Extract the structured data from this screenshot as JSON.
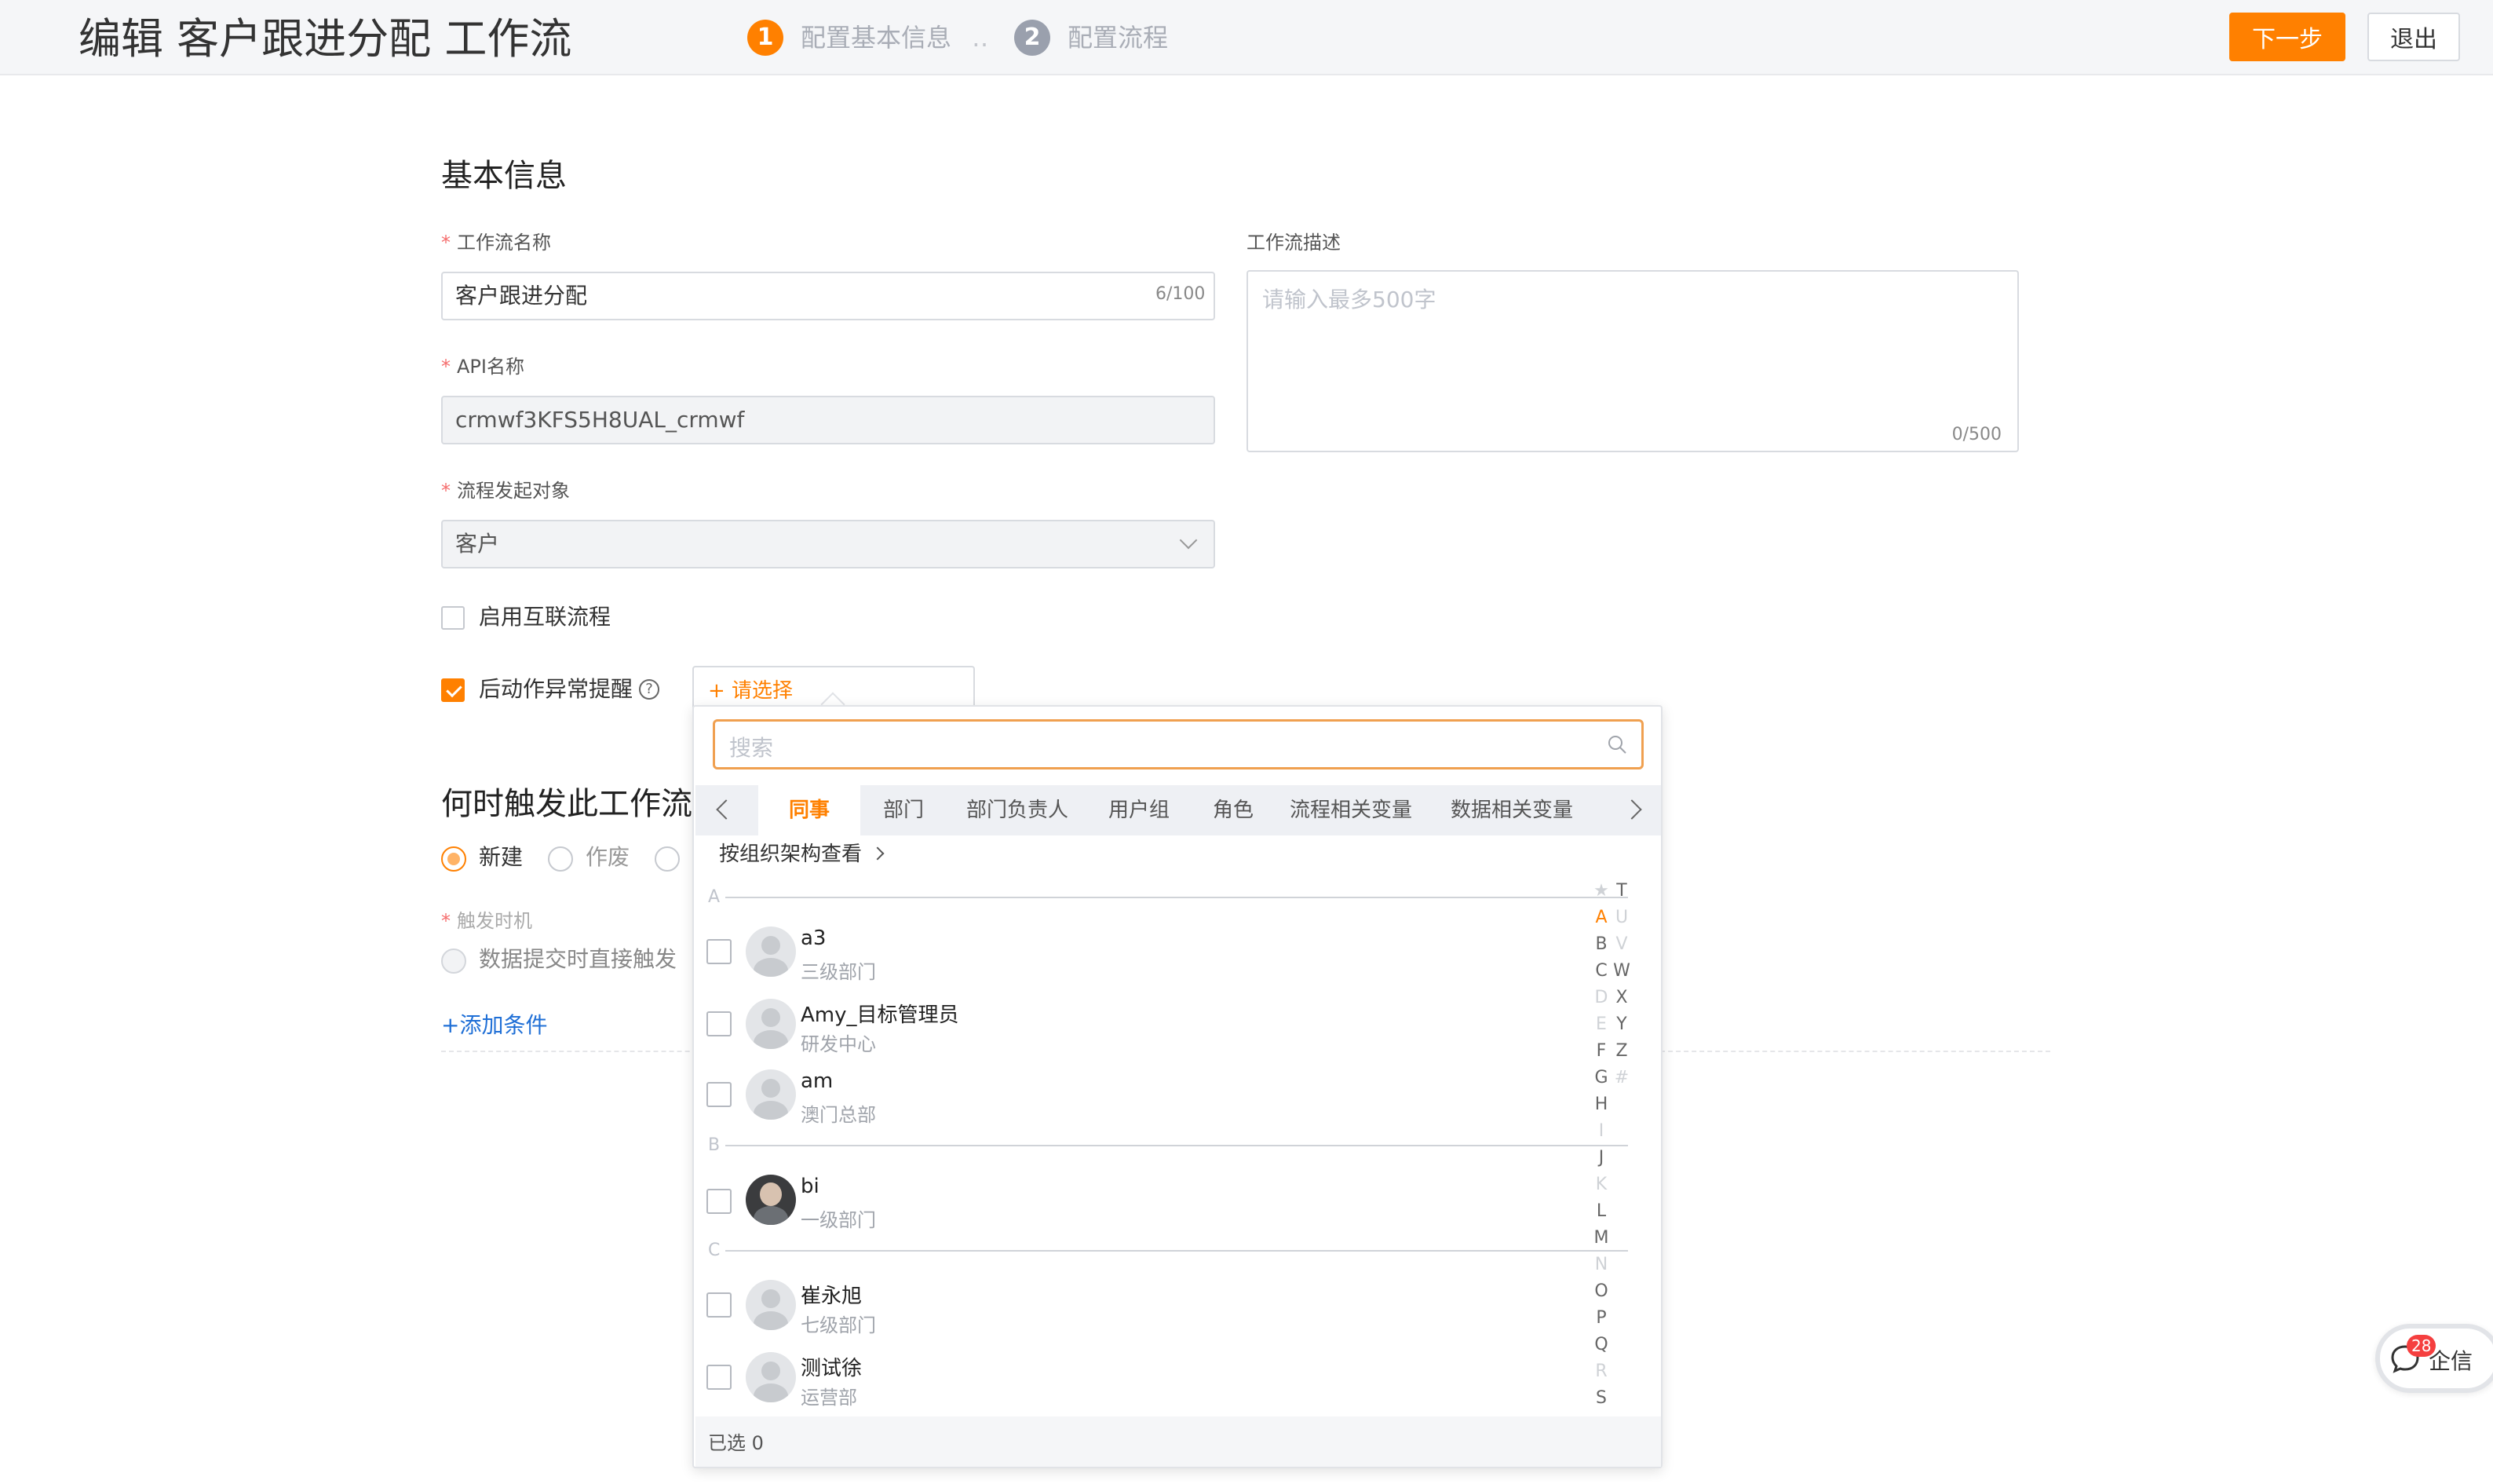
{
  "header": {
    "title": "编辑 客户跟进分配 工作流",
    "steps": [
      {
        "num": "1",
        "label": "配置基本信息"
      },
      {
        "num": "2",
        "label": "配置流程"
      }
    ],
    "step_dots": "‥",
    "next_label": "下一步",
    "exit_label": "退出",
    "accent_color": "#ff8000"
  },
  "basic": {
    "section_title": "基本信息",
    "name_label": "工作流名称",
    "name_value": "客户跟进分配",
    "name_counter": "6/100",
    "api_label": "API名称",
    "api_value": "crmwf3KFS5H8UAL_crmwf",
    "object_label": "流程发起对象",
    "object_value": "客户",
    "desc_label": "工作流描述",
    "desc_placeholder": "请输入最多500字",
    "desc_counter": "0/500",
    "interconnect_label": "启用互联流程",
    "alert_label": "后动作异常提醒",
    "select_placeholder": "+ 请选择"
  },
  "trigger": {
    "section_title": "何时触发此工作流",
    "options": [
      "新建",
      "作废"
    ],
    "timing_label": "触发时机",
    "timing_option": "数据提交时直接触发",
    "add_condition": "+添加条件"
  },
  "picker": {
    "search_placeholder": "搜索",
    "tabs": [
      "同事",
      "部门",
      "部门负责人",
      "用户组",
      "角色",
      "流程相关变量",
      "数据相关变量"
    ],
    "org_link": "按组织架构查看",
    "groups": [
      {
        "letter": "A",
        "people": [
          {
            "name": "a3",
            "dept": "三级部门"
          },
          {
            "name": "Amy_目标管理员",
            "dept": "研发中心"
          },
          {
            "name": "am",
            "dept": "澳门总部"
          }
        ]
      },
      {
        "letter": "B",
        "people": [
          {
            "name": "bi",
            "dept": "一级部门"
          }
        ]
      },
      {
        "letter": "C",
        "people": [
          {
            "name": "崔永旭",
            "dept": "七级部门"
          },
          {
            "name": "测试徐",
            "dept": "运营部"
          }
        ]
      }
    ],
    "alphabet_left": [
      "★",
      "A",
      "B",
      "C",
      "D",
      "E",
      "F",
      "G",
      "H",
      "I",
      "J",
      "K",
      "L",
      "M",
      "N",
      "O",
      "P",
      "Q",
      "R",
      "S"
    ],
    "alphabet_right": [
      "T",
      "U",
      "V",
      "W",
      "X",
      "Y",
      "Z",
      "#"
    ],
    "selected_text": "已选 0"
  },
  "chat": {
    "label": "企信",
    "badge": "28"
  }
}
